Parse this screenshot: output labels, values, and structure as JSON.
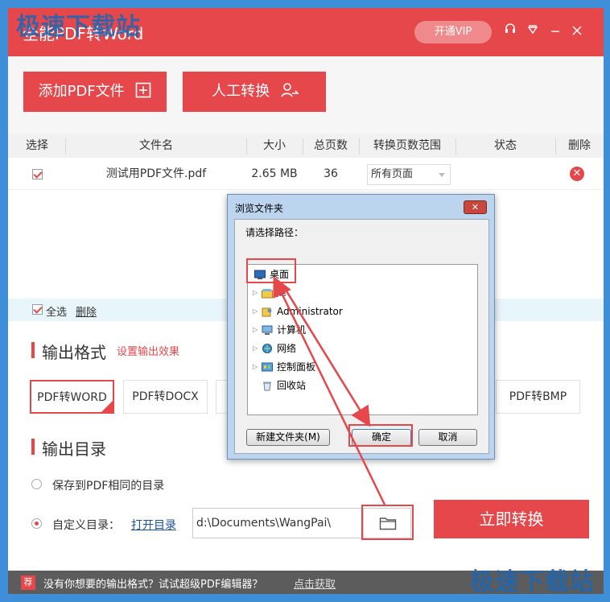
{
  "watermark_top": "极速下载站",
  "watermark_bottom": "极速下载站",
  "app": {
    "title": "全能PDF转Word",
    "vip_label": "开通VIP",
    "icons": [
      "headset-icon",
      "skin-icon",
      "minimize-icon",
      "close-icon"
    ]
  },
  "toolbar": {
    "add_pdf_label": "添加PDF文件",
    "manual_label": "人工转换"
  },
  "table": {
    "headers": [
      "选择",
      "文件名",
      "大小",
      "总页数",
      "转换页数范围",
      "状态",
      "删除"
    ],
    "rows": [
      {
        "checked": true,
        "filename": "测试用PDF文件.pdf",
        "size": "2.65 MB",
        "pages": "36",
        "range": "所有页面",
        "status": ""
      }
    ]
  },
  "selection": {
    "select_all_label": "全选",
    "delete_label": "删除"
  },
  "output_format": {
    "title": "输出格式",
    "settings_link": "设置输出效果",
    "formats": [
      "PDF转WORD",
      "PDF转DOCX",
      "PDF转BMP"
    ],
    "selected": "PDF转WORD"
  },
  "output_dir": {
    "title": "输出目录",
    "option_same": "保存到PDF相同的目录",
    "option_custom": "自定义目录：",
    "open_dir_link": "打开目录",
    "path_value": "d:\\Documents\\WangPai\\",
    "selected": "custom"
  },
  "convert_label": "立即转换",
  "bottom_bar": {
    "badge": "荐",
    "message": "没有你想要的输出格式？试试超级PDF编辑器？",
    "link": "点击获取"
  },
  "dialog": {
    "title": "浏览文件夹",
    "close": "✕",
    "prompt": "请选择路径：",
    "tree": [
      {
        "label": "桌面",
        "expander": false,
        "icon": "desktop-icon",
        "indent": 0,
        "selected": true
      },
      {
        "label": "库",
        "expander": true,
        "icon": "library-icon",
        "indent": 1
      },
      {
        "label": "Administrator",
        "expander": true,
        "icon": "user-folder-icon",
        "indent": 1
      },
      {
        "label": "计算机",
        "expander": true,
        "icon": "computer-icon",
        "indent": 1
      },
      {
        "label": "网络",
        "expander": true,
        "icon": "network-icon",
        "indent": 1
      },
      {
        "label": "控制面板",
        "expander": true,
        "icon": "control-panel-icon",
        "indent": 1
      },
      {
        "label": "回收站",
        "expander": false,
        "icon": "recycle-bin-icon",
        "indent": 1
      }
    ],
    "new_folder_label": "新建文件夹(M)",
    "ok_label": "确定",
    "cancel_label": "取消"
  },
  "colors": {
    "accent": "#e5474b",
    "titlebar": "#e5474b",
    "desktop_bg": "#3f8fd8",
    "dialog_frame": "#bcd4ee"
  }
}
